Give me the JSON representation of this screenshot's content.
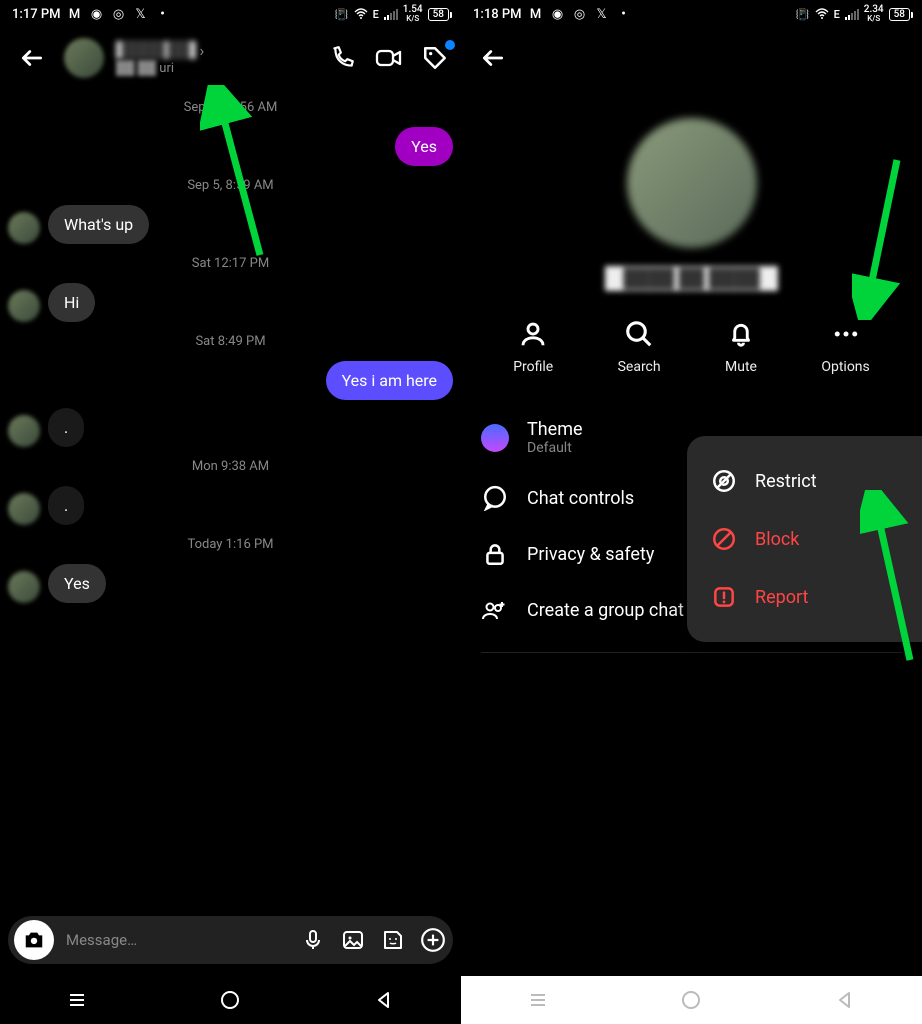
{
  "left_status": {
    "time": "1:17 PM",
    "speed": "1.54",
    "unit": "K/S",
    "battery": "58",
    "net": "E"
  },
  "right_status": {
    "time": "1:18 PM",
    "speed": "2.34",
    "unit": "K/S",
    "battery": "58",
    "net": "E"
  },
  "chat_header": {
    "sub": "uri"
  },
  "timestamps": {
    "t1": "Sep 1, 12:56 AM",
    "t2": "Sep 5, 8:59 AM",
    "t3": "Sat 12:17 PM",
    "t4": "Sat 8:49 PM",
    "t5": "Mon 9:38 AM",
    "t6": "Today 1:16 PM"
  },
  "messages": {
    "m1": "Yes",
    "m2": "What's up",
    "m3": "Hi",
    "m4": "Yes i am here",
    "m5": ".",
    "m6": ".",
    "m7": "Yes"
  },
  "input": {
    "placeholder": "Message…"
  },
  "actions": {
    "profile": "Profile",
    "search": "Search",
    "mute": "Mute",
    "options": "Options"
  },
  "settings": {
    "theme": "Theme",
    "theme_sub": "Default",
    "chat_controls": "Chat controls",
    "privacy": "Privacy & safety",
    "group": "Create a group chat"
  },
  "popup": {
    "restrict": "Restrict",
    "block": "Block",
    "report": "Report"
  }
}
